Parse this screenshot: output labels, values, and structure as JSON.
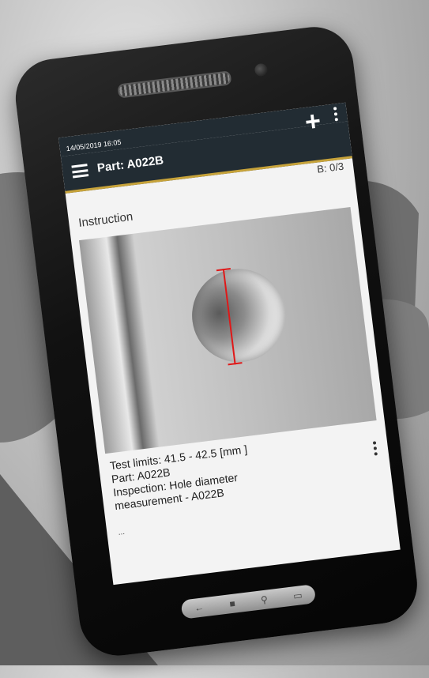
{
  "status_bar": {
    "datetime": "14/05/2019 16:05"
  },
  "app_bar": {
    "title": "Part: A022B",
    "add_icon": "plus-icon",
    "more_icon": "kebab-icon",
    "accent_color": "#c7a33a",
    "bar_color": "#222c33"
  },
  "header": {
    "batch_counter": "B: 0/3",
    "section_title": "Instruction"
  },
  "inspection": {
    "test_limits": "Test limits: 41.5 - 42.5 [mm ]",
    "part": "Part: A022B",
    "inspection_line1": "Inspection: Hole diameter",
    "inspection_line2": "measurement - A022B",
    "ellipsis": "..."
  },
  "photo": {
    "measure_line_color": "#e01818"
  },
  "nav_buttons": [
    "back-icon",
    "home-icon",
    "search-icon",
    "recent-apps-icon"
  ]
}
